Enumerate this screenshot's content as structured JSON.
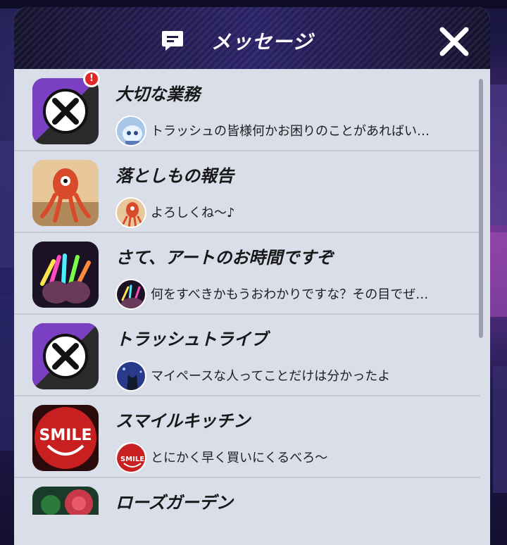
{
  "header": {
    "title": "メッセージ",
    "icon": "chat-bubble-icon",
    "close_icon": "close-icon"
  },
  "colors": {
    "panel_bg": "#d9dee9",
    "header_bg": "#1f1a4a",
    "title_text": "#181818",
    "badge": "#e02828"
  },
  "messages": [
    {
      "title": "大切な業務",
      "preview": "トラッシュの皆様何かお困りのことがあればい…",
      "icon": "trash-x-icon",
      "avatar": "robot-avatar",
      "unread_badge": "!"
    },
    {
      "title": "落としもの報告",
      "preview": "よろしくね～♪",
      "icon": "octopus-icon",
      "avatar": "octopus-avatar"
    },
    {
      "title": "さて、アートのお時間ですぞ",
      "preview": "何をすべきかもうおわかりですな？その目でぜ…",
      "icon": "glowsticks-icon",
      "avatar": "glowsticks-avatar"
    },
    {
      "title": "トラッシュトライブ",
      "preview": "マイペースな人ってことだけは分かったよ",
      "icon": "trash-x-icon",
      "avatar": "cat-avatar"
    },
    {
      "title": "スマイルキッチン",
      "preview": "とにかく早く買いにくるべろ～",
      "icon": "smile-logo-icon",
      "avatar": "smile-avatar",
      "logo_text": "SMILE"
    },
    {
      "title": "ローズガーデン",
      "icon": "rose-icon"
    }
  ]
}
